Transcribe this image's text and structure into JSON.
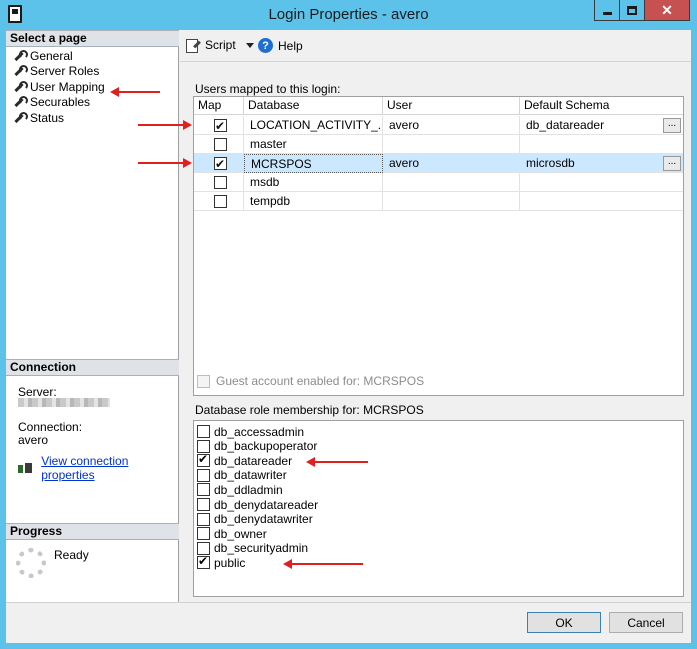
{
  "window": {
    "title": "Login Properties - avero"
  },
  "sidebar": {
    "select_page_header": "Select a page",
    "items": [
      {
        "label": "General"
      },
      {
        "label": "Server Roles"
      },
      {
        "label": "User Mapping"
      },
      {
        "label": "Securables"
      },
      {
        "label": "Status"
      }
    ],
    "connection_header": "Connection",
    "server_label": "Server:",
    "connection_label": "Connection:",
    "connection_value": "avero",
    "view_connection_link": "View connection properties",
    "progress_header": "Progress",
    "progress_status": "Ready"
  },
  "toolbar": {
    "script_label": "Script",
    "help_label": "Help"
  },
  "users_mapped": {
    "label": "Users mapped to this login:",
    "columns": [
      "Map",
      "Database",
      "User",
      "Default Schema"
    ],
    "rows": [
      {
        "checked": true,
        "database": "LOCATION_ACTIVITY_...",
        "user": "avero",
        "schema": "db_datareader",
        "has_button": true,
        "selected": false
      },
      {
        "checked": false,
        "database": "master",
        "user": "",
        "schema": "",
        "has_button": false,
        "selected": false
      },
      {
        "checked": true,
        "database": "MCRSPOS",
        "user": "avero",
        "schema": "microsdb",
        "has_button": true,
        "selected": true
      },
      {
        "checked": false,
        "database": "msdb",
        "user": "",
        "schema": "",
        "has_button": false,
        "selected": false
      },
      {
        "checked": false,
        "database": "tempdb",
        "user": "",
        "schema": "",
        "has_button": false,
        "selected": false
      }
    ],
    "ellipsis": "..."
  },
  "guest": {
    "label": "Guest account enabled for: MCRSPOS",
    "checked": false
  },
  "roles": {
    "label": "Database role membership for: MCRSPOS",
    "items": [
      {
        "name": "db_accessadmin",
        "checked": false
      },
      {
        "name": "db_backupoperator",
        "checked": false
      },
      {
        "name": "db_datareader",
        "checked": true
      },
      {
        "name": "db_datawriter",
        "checked": false
      },
      {
        "name": "db_ddladmin",
        "checked": false
      },
      {
        "name": "db_denydatareader",
        "checked": false
      },
      {
        "name": "db_denydatawriter",
        "checked": false
      },
      {
        "name": "db_owner",
        "checked": false
      },
      {
        "name": "db_securityadmin",
        "checked": false
      },
      {
        "name": "public",
        "checked": true
      }
    ]
  },
  "footer": {
    "ok_label": "OK",
    "cancel_label": "Cancel"
  },
  "colors": {
    "titlebar": "#5dc2ea",
    "close": "#c75050",
    "selection": "#cce8ff",
    "annotation_arrow": "#e02020",
    "link": "#0033cc"
  }
}
